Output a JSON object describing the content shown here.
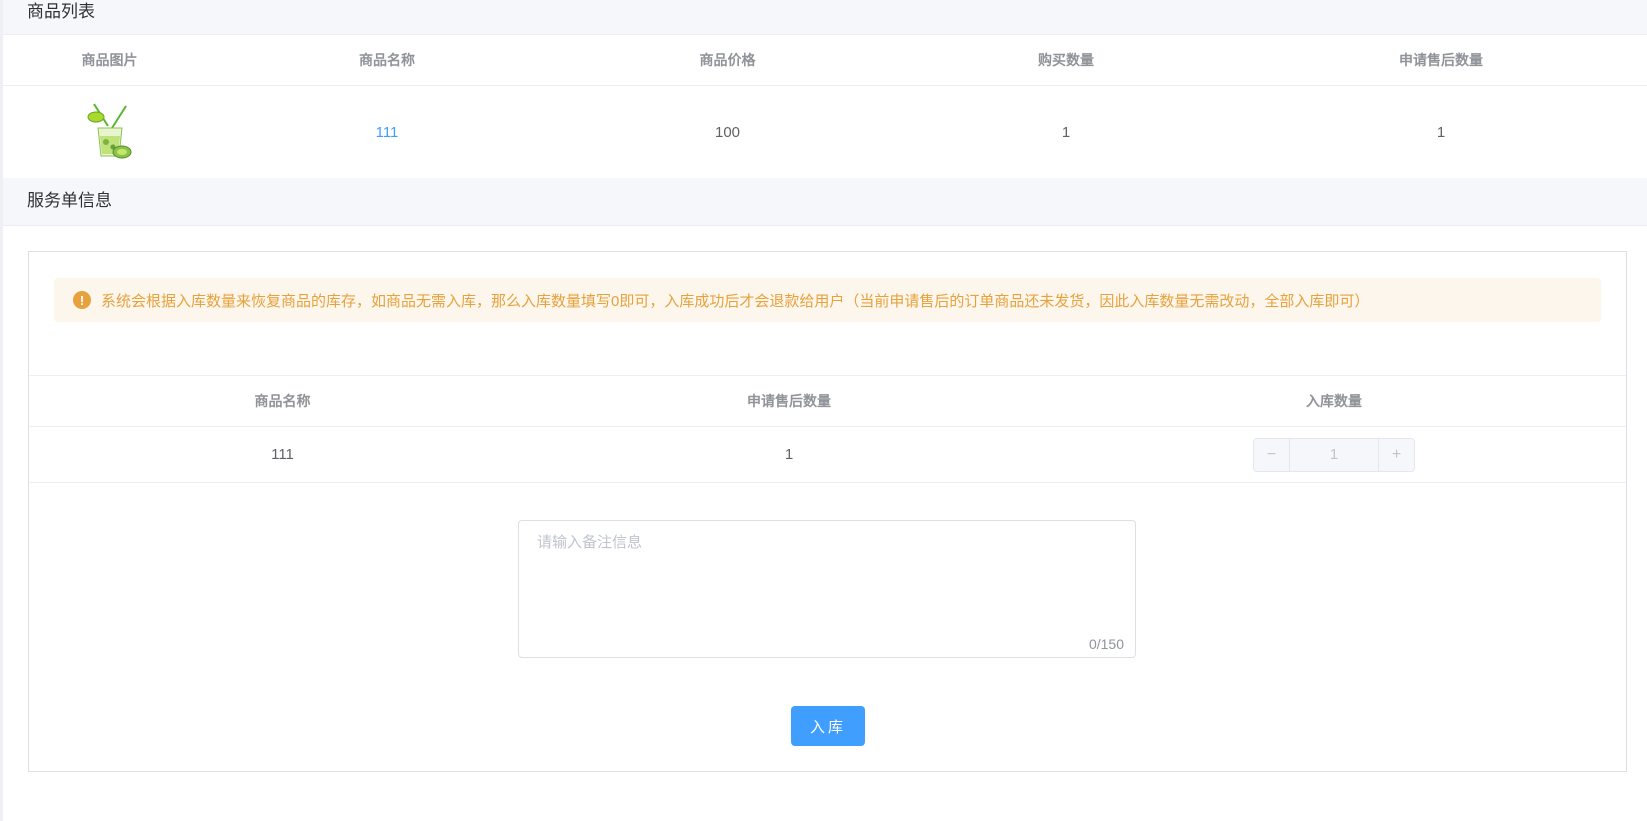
{
  "goods_section": {
    "title": "商品列表",
    "columns": [
      "商品图片",
      "商品名称",
      "商品价格",
      "购买数量",
      "申请售后数量"
    ],
    "rows": [
      {
        "image_icon": "lime-drink-icon",
        "name": "111",
        "price": "100",
        "buy_qty": "1",
        "apply_qty": "1"
      }
    ]
  },
  "service_section": {
    "title": "服务单信息",
    "alert_icon": "warning-icon",
    "alert_text": "系统会根据入库数量来恢复商品的库存，如商品无需入库，那么入库数量填写0即可，入库成功后才会退款给用户（当前申请售后的订单商品还未发货，因此入库数量无需改动，全部入库即可）",
    "columns": [
      "商品名称",
      "申请售后数量",
      "入库数量"
    ],
    "rows": [
      {
        "name": "111",
        "apply_qty": "1",
        "stock_qty": "1"
      }
    ],
    "stepper": {
      "minus": "−",
      "plus": "+"
    },
    "remark": {
      "placeholder": "请输入备注信息",
      "value": "",
      "counter": "0/150"
    },
    "submit_label": "入库"
  },
  "colors": {
    "primary": "#409eff",
    "warning": "#e6a23c",
    "warning_bg": "#fdf6ec",
    "header_bg": "#f5f7fa"
  }
}
